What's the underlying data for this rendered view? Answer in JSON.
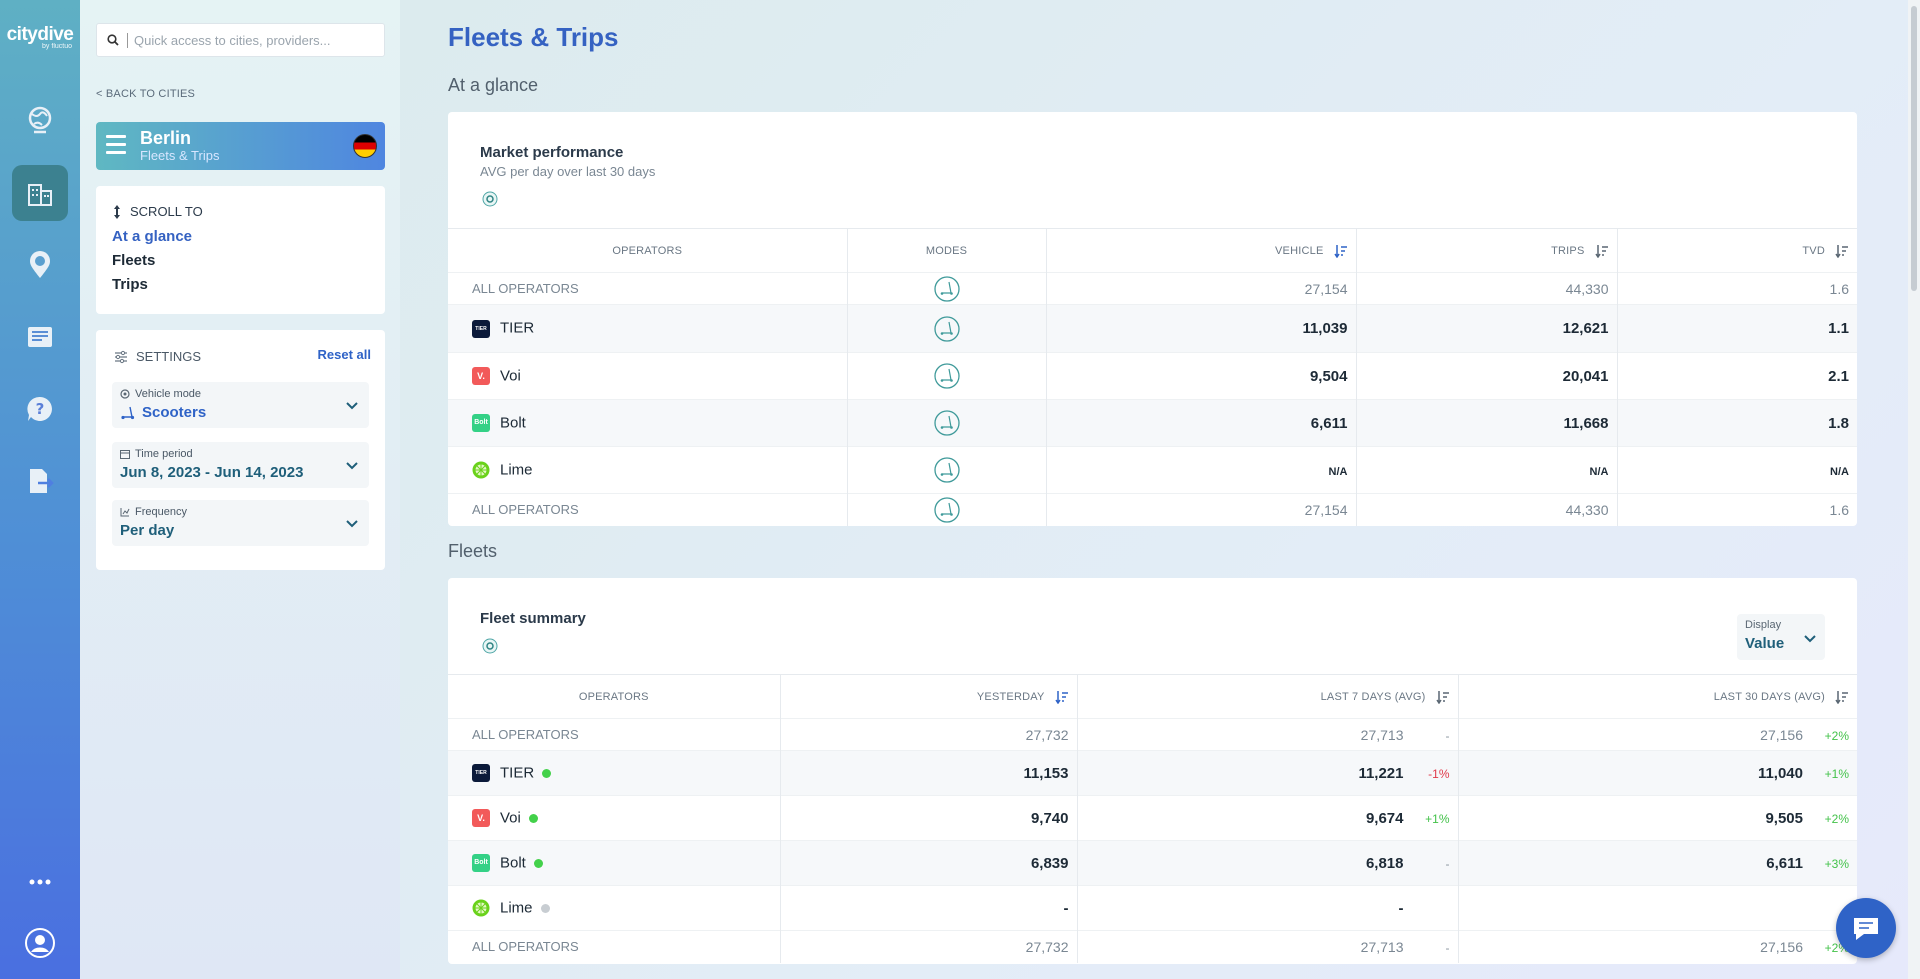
{
  "brand": {
    "name": "citydive",
    "tagline": "by fluctuo"
  },
  "search": {
    "placeholder": "Quick access to cities, providers..."
  },
  "nav": {
    "back_label": "< BACK TO CITIES"
  },
  "city": {
    "name": "Berlin",
    "section": "Fleets & Trips"
  },
  "scroll_to": {
    "heading": "SCROLL TO",
    "items": [
      {
        "label": "At a glance",
        "active": true
      },
      {
        "label": "Fleets",
        "active": false
      },
      {
        "label": "Trips",
        "active": false
      }
    ]
  },
  "settings": {
    "heading": "SETTINGS",
    "reset_label": "Reset all",
    "vehicle_mode": {
      "label": "Vehicle mode",
      "value": "Scooters"
    },
    "time_period": {
      "label": "Time period",
      "value": "Jun 8, 2023 - Jun 14, 2023"
    },
    "frequency": {
      "label": "Frequency",
      "value": "Per day"
    }
  },
  "page": {
    "title": "Fleets & Trips",
    "section_glance": "At a glance",
    "section_fleets": "Fleets"
  },
  "market": {
    "title": "Market performance",
    "subtitle": "AVG per day over last 30 days",
    "columns": {
      "operators": "OPERATORS",
      "modes": "MODES",
      "vehicle": "VEHICLE",
      "trips": "TRIPS",
      "tvd": "TVD"
    },
    "rows": [
      {
        "operator": "ALL OPERATORS",
        "vehicle": "27,154",
        "trips": "44,330",
        "tvd": "1.6"
      },
      {
        "operator": "TIER",
        "vehicle": "11,039",
        "trips": "12,621",
        "tvd": "1.1"
      },
      {
        "operator": "Voi",
        "vehicle": "9,504",
        "trips": "20,041",
        "tvd": "2.1"
      },
      {
        "operator": "Bolt",
        "vehicle": "6,611",
        "trips": "11,668",
        "tvd": "1.8"
      },
      {
        "operator": "Lime",
        "vehicle": "N/A",
        "trips": "N/A",
        "tvd": "N/A"
      },
      {
        "operator": "ALL OPERATORS",
        "vehicle": "27,154",
        "trips": "44,330",
        "tvd": "1.6"
      }
    ]
  },
  "fleet": {
    "title": "Fleet summary",
    "display": {
      "label": "Display",
      "value": "Value"
    },
    "columns": {
      "operators": "OPERATORS",
      "yesterday": "YESTERDAY",
      "last7": "LAST 7 DAYS (AVG)",
      "last30": "LAST 30 DAYS (AVG)"
    },
    "rows": [
      {
        "operator": "ALL OPERATORS",
        "yesterday": "27,732",
        "last7": "27,713",
        "last7_chg": "-",
        "last30": "27,156",
        "last30_chg": "+2%"
      },
      {
        "operator": "TIER",
        "yesterday": "11,153",
        "last7": "11,221",
        "last7_chg": "-1%",
        "last30": "11,040",
        "last30_chg": "+1%"
      },
      {
        "operator": "Voi",
        "yesterday": "9,740",
        "last7": "9,674",
        "last7_chg": "+1%",
        "last30": "9,505",
        "last30_chg": "+2%"
      },
      {
        "operator": "Bolt",
        "yesterday": "6,839",
        "last7": "6,818",
        "last7_chg": "-",
        "last30": "6,611",
        "last30_chg": "+3%"
      },
      {
        "operator": "Lime",
        "yesterday": "-",
        "last7": "-",
        "last7_chg": "",
        "last30": "",
        "last30_chg": ""
      },
      {
        "operator": "ALL OPERATORS",
        "yesterday": "27,732",
        "last7": "27,713",
        "last7_chg": "-",
        "last30": "27,156",
        "last30_chg": "+2%"
      }
    ]
  },
  "operator_logos": {
    "tier": "TIER",
    "voi": "V.",
    "bolt": "Bolt"
  },
  "colors": {
    "accent": "#3562c2",
    "positive": "#43c24a",
    "negative": "#e03a4a",
    "online": "#43d14a",
    "offline": "#c8cdd2"
  }
}
